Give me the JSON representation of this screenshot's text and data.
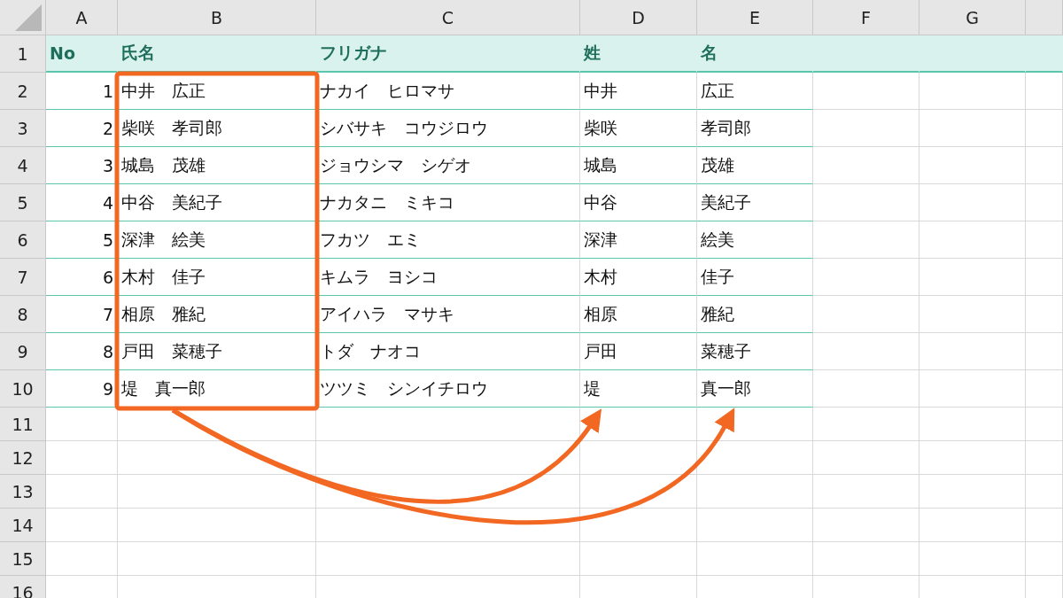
{
  "columns": [
    "A",
    "B",
    "C",
    "D",
    "E",
    "F",
    "G",
    ""
  ],
  "rows": [
    {
      "number": "1",
      "kind": "header",
      "cells": [
        "No",
        "氏名",
        "フリガナ",
        "姓",
        "名"
      ]
    },
    {
      "number": "2",
      "kind": "data",
      "cells": [
        "1",
        "中井　広正",
        "ナカイ　ヒロマサ",
        "中井",
        "広正"
      ]
    },
    {
      "number": "3",
      "kind": "data",
      "cells": [
        "2",
        "柴咲　孝司郎",
        "シバサキ　コウジロウ",
        "柴咲",
        "孝司郎"
      ]
    },
    {
      "number": "4",
      "kind": "data",
      "cells": [
        "3",
        "城島　茂雄",
        "ジョウシマ　シゲオ",
        "城島",
        "茂雄"
      ]
    },
    {
      "number": "5",
      "kind": "data",
      "cells": [
        "4",
        "中谷　美紀子",
        "ナカタニ　ミキコ",
        "中谷",
        "美紀子"
      ]
    },
    {
      "number": "6",
      "kind": "data",
      "cells": [
        "5",
        "深津　絵美",
        "フカツ　エミ",
        "深津",
        "絵美"
      ]
    },
    {
      "number": "7",
      "kind": "data",
      "cells": [
        "6",
        "木村　佳子",
        "キムラ　ヨシコ",
        "木村",
        "佳子"
      ]
    },
    {
      "number": "8",
      "kind": "data",
      "cells": [
        "7",
        "相原　雅紀",
        "アイハラ　マサキ",
        "相原",
        "雅紀"
      ]
    },
    {
      "number": "9",
      "kind": "data",
      "cells": [
        "8",
        "戸田　菜穂子",
        "トダ　ナオコ",
        "戸田",
        "菜穂子"
      ]
    },
    {
      "number": "10",
      "kind": "data",
      "cells": [
        "9",
        "堤　真一郎",
        "ツツミ　シンイチロウ",
        "堤",
        "真一郎"
      ]
    },
    {
      "number": "11",
      "kind": "blank",
      "cells": []
    },
    {
      "number": "12",
      "kind": "blank",
      "cells": []
    },
    {
      "number": "13",
      "kind": "blank",
      "cells": []
    },
    {
      "number": "14",
      "kind": "blank",
      "cells": []
    },
    {
      "number": "15",
      "kind": "blank",
      "cells": []
    },
    {
      "number": "16",
      "kind": "blank",
      "cells": []
    }
  ]
}
